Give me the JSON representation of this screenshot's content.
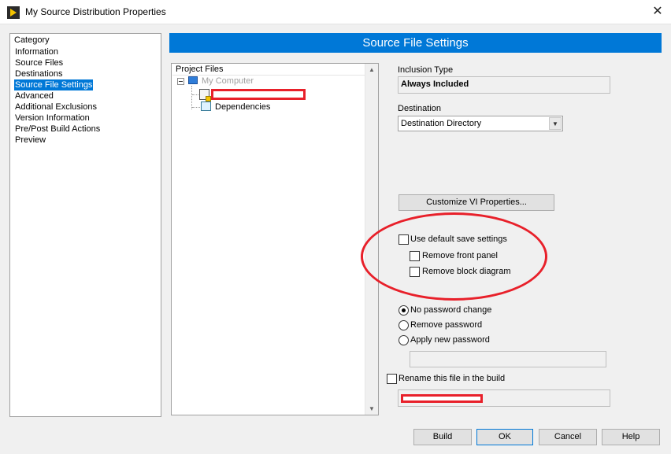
{
  "window": {
    "title": "My Source Distribution Properties",
    "close_glyph": "✕"
  },
  "category": {
    "header": "Category",
    "items": [
      {
        "label": "Information",
        "selected": false
      },
      {
        "label": "Source Files",
        "selected": false
      },
      {
        "label": "Destinations",
        "selected": false
      },
      {
        "label": "Source File Settings",
        "selected": true
      },
      {
        "label": "Advanced",
        "selected": false
      },
      {
        "label": "Additional Exclusions",
        "selected": false
      },
      {
        "label": "Version Information",
        "selected": false
      },
      {
        "label": "Pre/Post Build Actions",
        "selected": false
      },
      {
        "label": "Preview",
        "selected": false
      }
    ]
  },
  "banner": {
    "title": "Source File Settings"
  },
  "project_files": {
    "header": "Project Files",
    "tree": {
      "root_label": "My Computer",
      "dependencies_label": "Dependencies"
    }
  },
  "settings": {
    "inclusion_type_label": "Inclusion Type",
    "inclusion_type_value": "Always Included",
    "destination_label": "Destination",
    "destination_value": "Destination Directory",
    "customize_button": "Customize VI Properties...",
    "use_default_save": {
      "label": "Use default save settings",
      "checked": false
    },
    "remove_front_panel": {
      "label": "Remove front panel",
      "checked": false
    },
    "remove_block_diagram": {
      "label": "Remove block diagram",
      "checked": false
    },
    "password_options": [
      {
        "label": "No password change",
        "selected": true
      },
      {
        "label": "Remove password",
        "selected": false
      },
      {
        "label": "Apply new password",
        "selected": false
      }
    ],
    "password_value": "",
    "rename": {
      "label": "Rename this file in the build",
      "checked": false
    }
  },
  "buttons": {
    "build": "Build",
    "ok": "OK",
    "cancel": "Cancel",
    "help": "Help"
  },
  "colors": {
    "accent": "#0078d7",
    "annotation": "#e8202a"
  }
}
